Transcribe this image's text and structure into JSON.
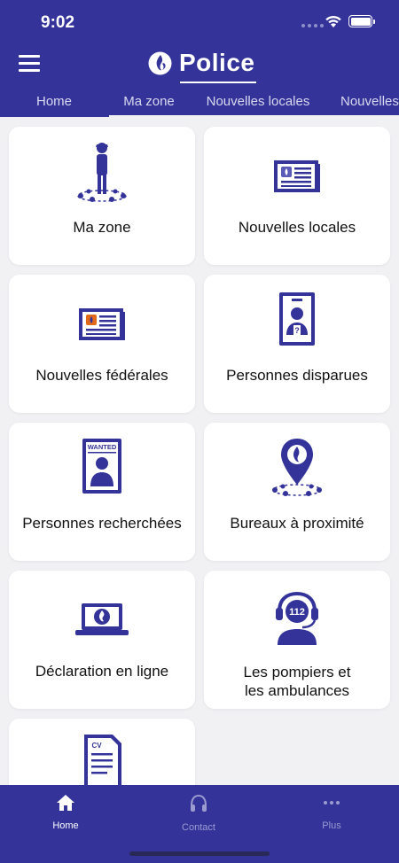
{
  "status_bar": {
    "time": "9:02"
  },
  "header": {
    "brand": "Police"
  },
  "tabs": [
    {
      "label": "Home"
    },
    {
      "label": "Ma zone"
    },
    {
      "label": "Nouvelles locales"
    },
    {
      "label": "Nouvelles"
    }
  ],
  "tiles": [
    {
      "label": "Ma zone",
      "icon": "zone-person-icon"
    },
    {
      "label": "Nouvelles locales",
      "icon": "local-newspaper-icon"
    },
    {
      "label": "Nouvelles fédérales",
      "icon": "federal-newspaper-icon"
    },
    {
      "label": "Personnes disparues",
      "icon": "missing-person-icon"
    },
    {
      "label": "Personnes recherchées",
      "icon": "wanted-poster-icon"
    },
    {
      "label": "Bureaux à proximité",
      "icon": "map-pin-icon"
    },
    {
      "label": "Déclaration en ligne",
      "icon": "laptop-icon"
    },
    {
      "label_line1": "Les pompiers et",
      "label_line2": "les ambulances",
      "icon": "emergency-112-icon",
      "badge": "112"
    },
    {
      "label": "",
      "icon": "cv-document-icon",
      "badge": "CV"
    }
  ],
  "wanted_text": "WANTED",
  "bottom_nav": [
    {
      "label": "Home",
      "icon": "home-icon"
    },
    {
      "label": "Contact",
      "icon": "headphones-icon"
    },
    {
      "label": "Plus",
      "icon": "more-dots-icon"
    }
  ],
  "colors": {
    "brand": "#33339a",
    "background": "#f1f1f4",
    "accent": "#e06a1b"
  }
}
